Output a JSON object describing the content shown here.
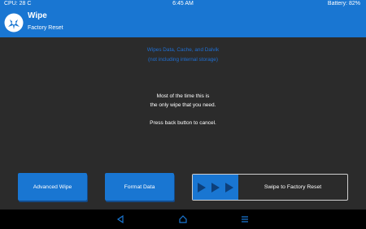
{
  "status_bar": {
    "cpu": "CPU: 28 C",
    "time": "6:45 AM",
    "battery": "Battery: 82%"
  },
  "header": {
    "title": "Wipe",
    "subtitle": "Factory Reset"
  },
  "info": {
    "line1": "Wipes Data, Cache, and Dalvik",
    "line2": "(not including internal storage)"
  },
  "message": {
    "line1": "Most of the time this is",
    "line2": "the only wipe that you need.",
    "line3": "Press back button to cancel."
  },
  "buttons": {
    "advanced": "Advanced Wipe",
    "format": "Format Data"
  },
  "swipe": {
    "label": "Swipe to Factory Reset"
  },
  "nav": {
    "back": "back-icon",
    "home": "home-icon",
    "menu": "menu-icon"
  },
  "colors": {
    "accent": "#1976d2",
    "background": "#2b2b2b",
    "info_text": "#1f6fd3"
  }
}
